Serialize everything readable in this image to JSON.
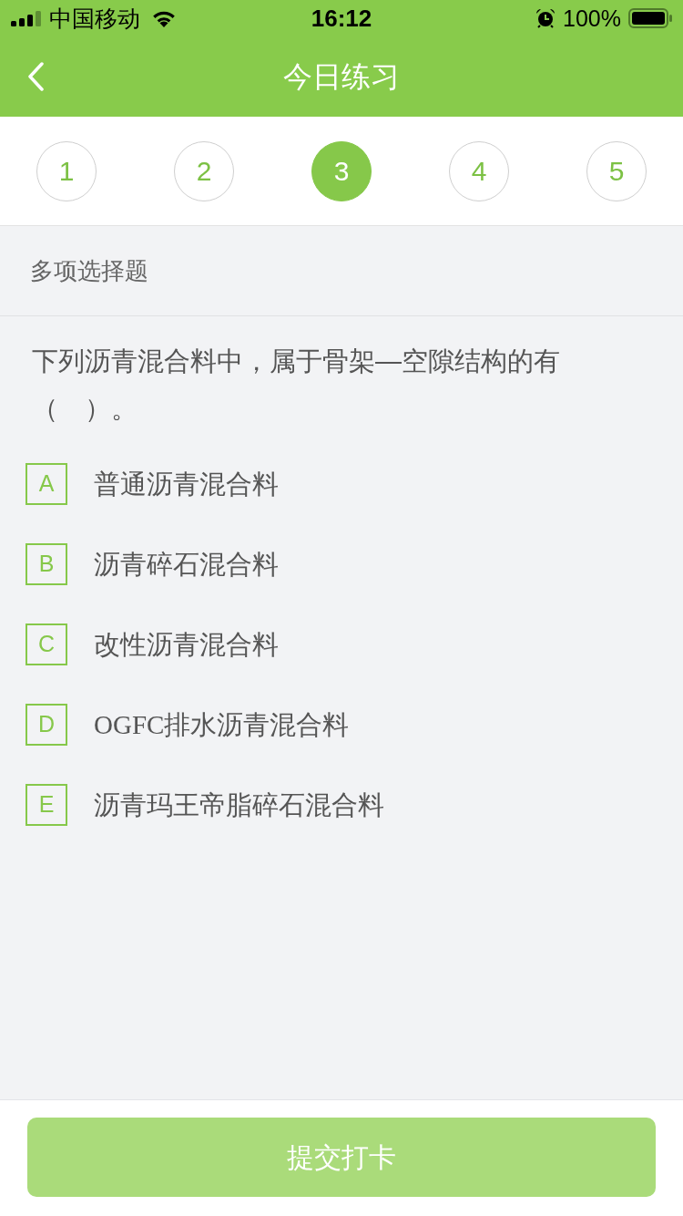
{
  "status_bar": {
    "carrier": "中国移动",
    "time": "16:12",
    "battery": "100%"
  },
  "nav_bar": {
    "title": "今日练习"
  },
  "question_tabs": [
    {
      "label": "1",
      "selected": false
    },
    {
      "label": "2",
      "selected": false
    },
    {
      "label": "3",
      "selected": true
    },
    {
      "label": "4",
      "selected": false
    },
    {
      "label": "5",
      "selected": false
    }
  ],
  "section": {
    "title": "多项选择题"
  },
  "question": {
    "text": "下列沥青混合料中，属于骨架—空隙结构的有（　）。",
    "options": [
      {
        "letter": "A",
        "text": "普通沥青混合料",
        "selected": false
      },
      {
        "letter": "B",
        "text": "沥青碎石混合料",
        "selected": false
      },
      {
        "letter": "C",
        "text": "改性沥青混合料",
        "selected": false
      },
      {
        "letter": "D",
        "text": "OGFC排水沥青混合料",
        "selected": false
      },
      {
        "letter": "E",
        "text": "沥青玛王帝脂碎石混合料",
        "selected": false
      }
    ]
  },
  "submit_button": {
    "label": "提交打卡",
    "disabled": true
  }
}
